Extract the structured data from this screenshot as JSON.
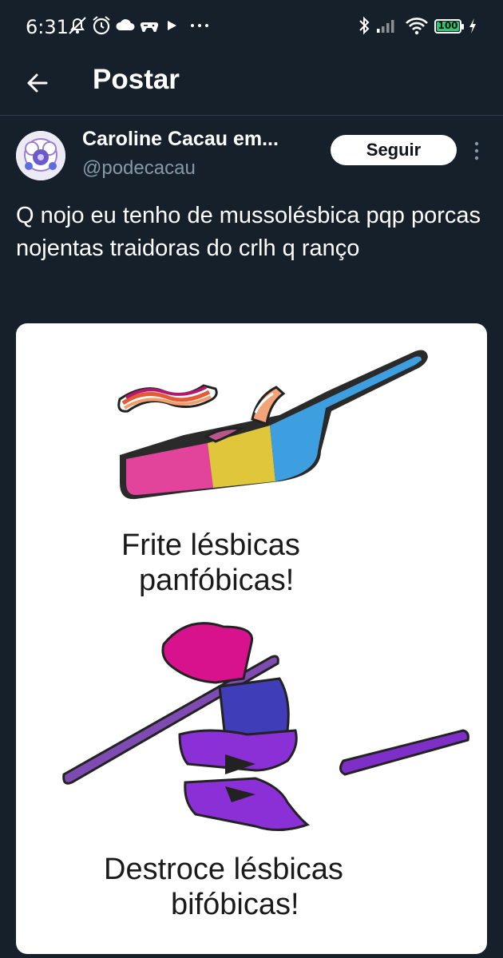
{
  "status_bar": {
    "time": "6:31",
    "battery": "100"
  },
  "header": {
    "title": "Postar"
  },
  "tweet": {
    "display_name": "Caroline Cacau em...",
    "handle": "@podecacau",
    "follow_label": "Seguir",
    "text": "Q nojo eu tenho de mussolésbica pqp porcas nojentas traidoras do crlh q ranço"
  },
  "media": {
    "caption_top_line1": "Frite lésbicas",
    "caption_top_line2": "panfóbicas!",
    "caption_bottom_line1": "Destroce lésbicas",
    "caption_bottom_line2": "bifóbicas!"
  },
  "colors": {
    "background": "#15202b",
    "pan_pink": "#e0339a",
    "pan_yellow": "#e2c93a",
    "pan_blue": "#3a9ee0",
    "bi_magenta": "#d6027a",
    "bi_purple": "#8a2be2",
    "bi_blue": "#3b3bc2"
  }
}
